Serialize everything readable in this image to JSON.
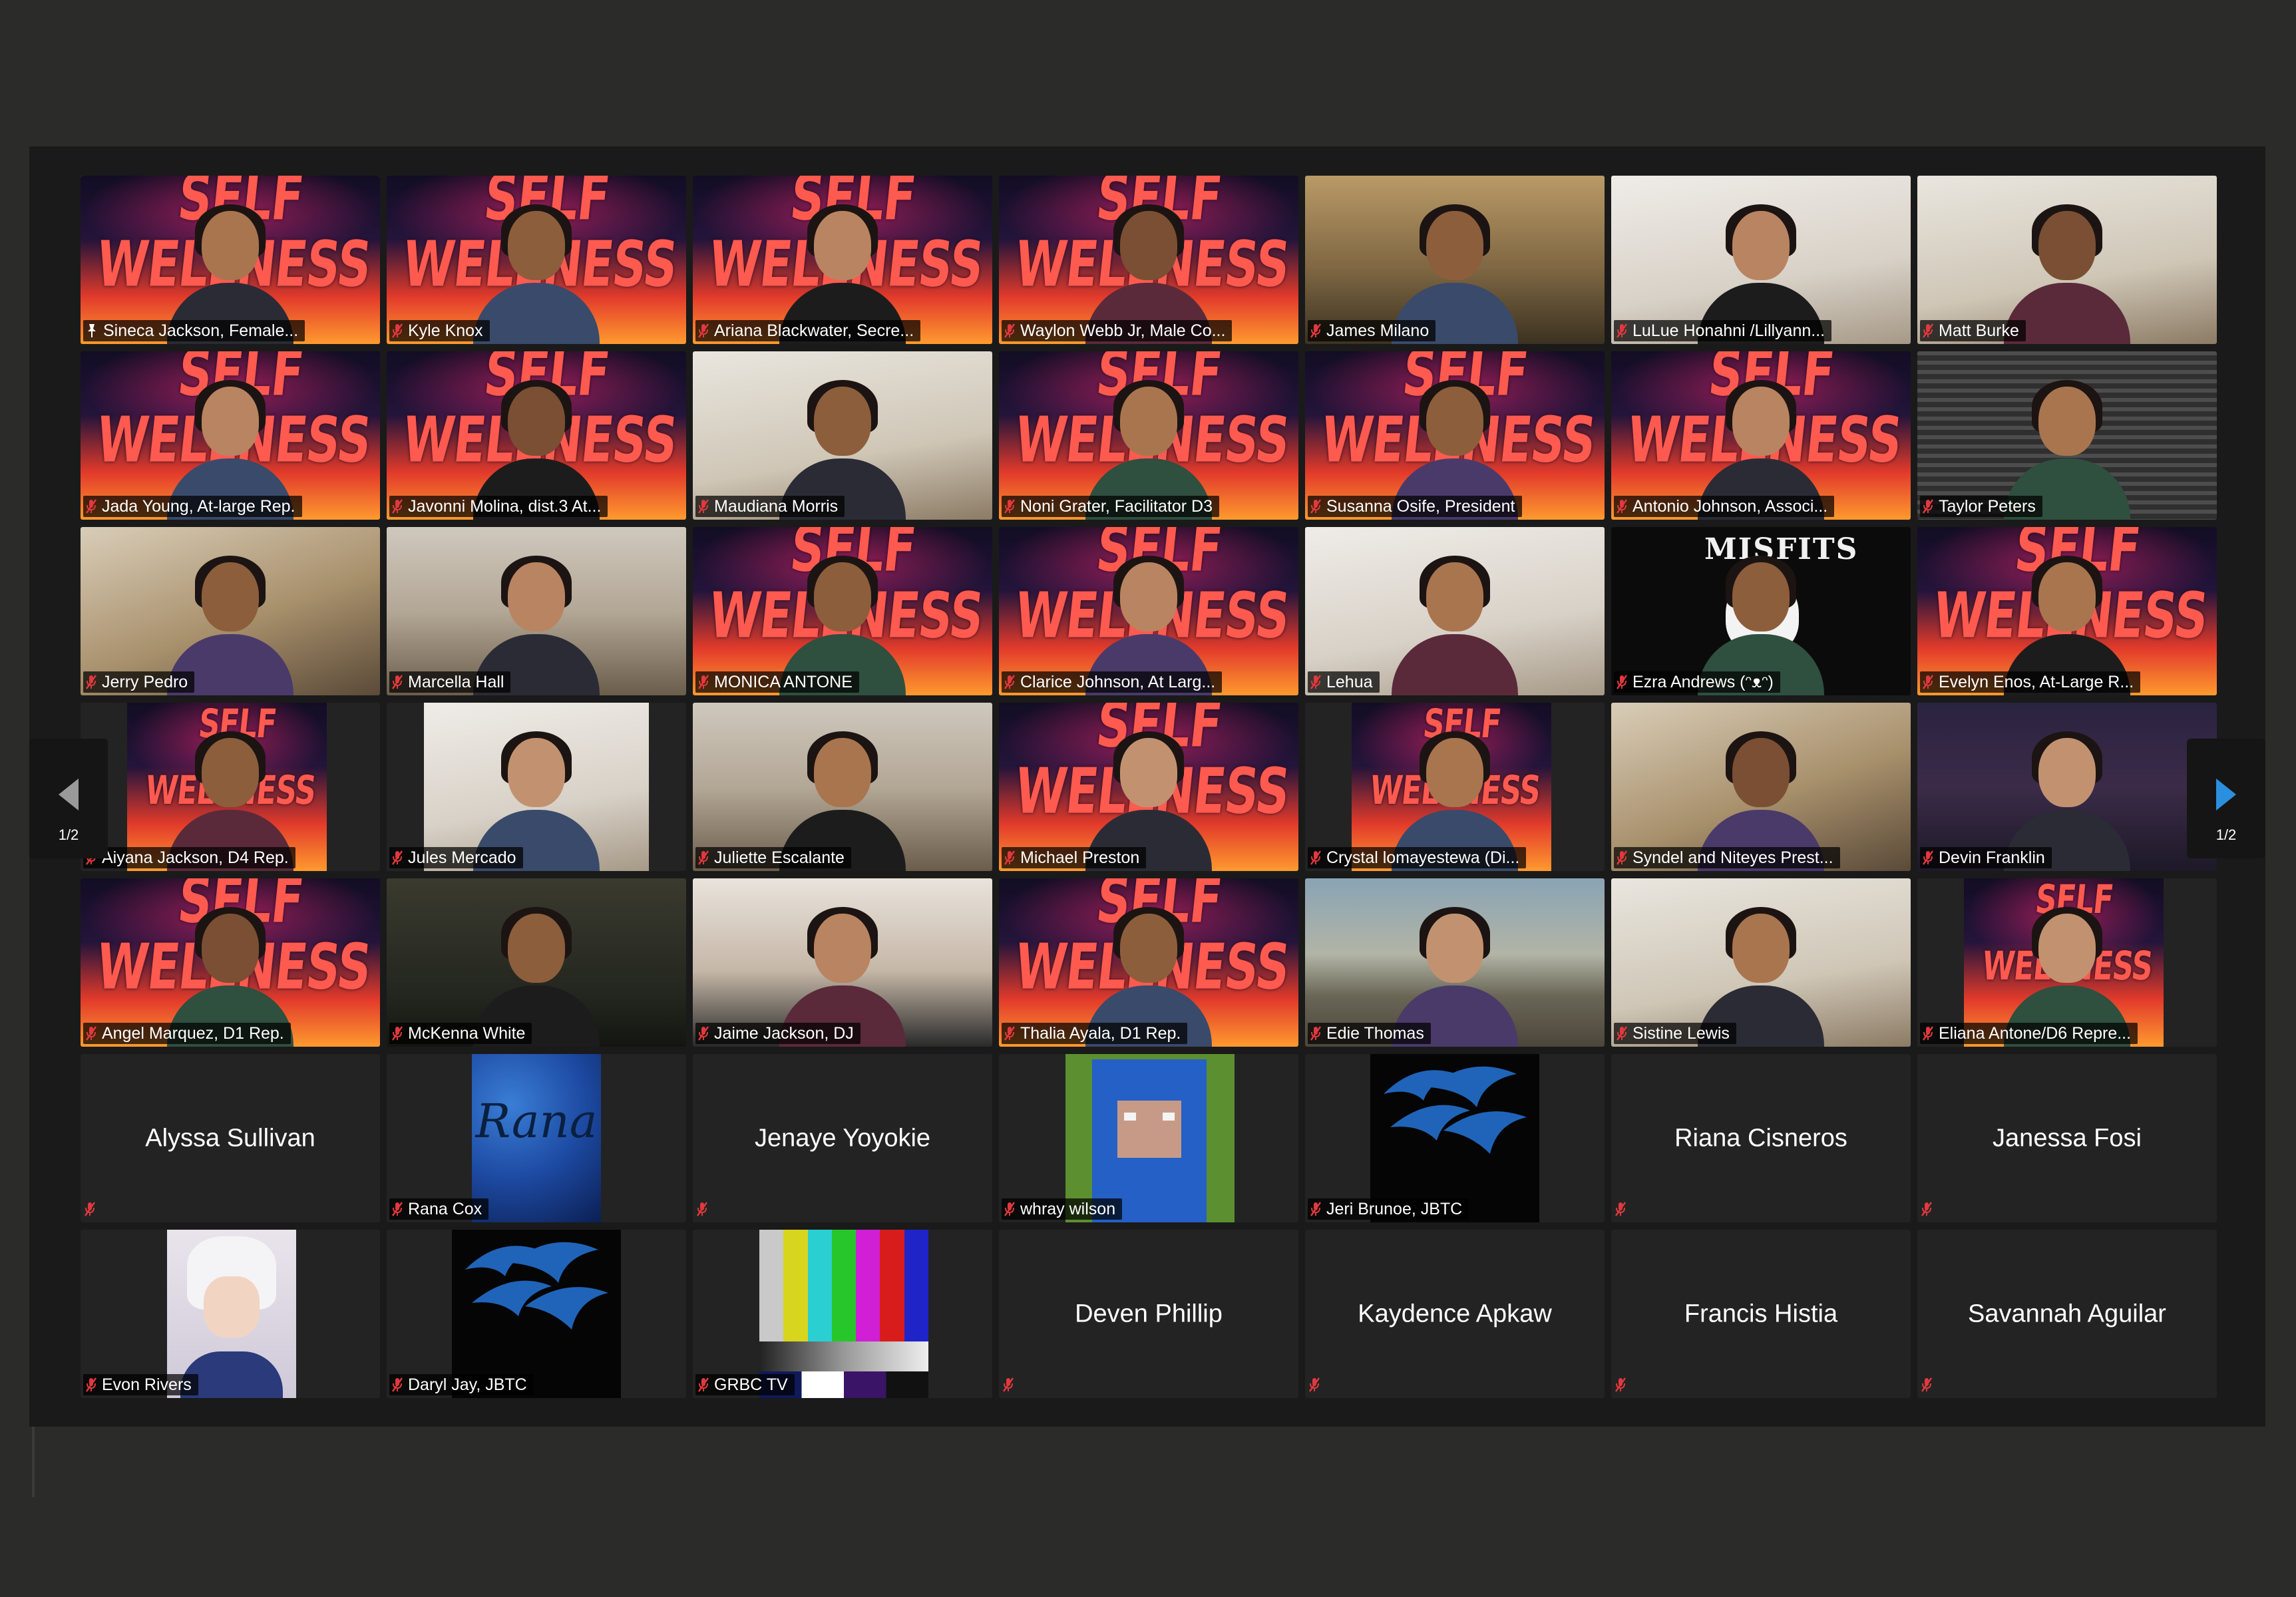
{
  "pagination": {
    "left_label": "1/2",
    "right_label": "1/2"
  },
  "colors": {
    "active_speaker_border": "#d9e36a",
    "muted_icon": "#e0393e",
    "tile_bg": "#232323"
  },
  "poster_text": "SELF WELLNESS AND GROWTH",
  "participants": [
    {
      "name": "Sineca Jackson, Female...",
      "bg": "poster",
      "active": true,
      "pinned": true
    },
    {
      "name": "Kyle Knox",
      "bg": "poster"
    },
    {
      "name": "Ariana Blackwater, Secre...",
      "bg": "poster"
    },
    {
      "name": "Waylon Webb Jr, Male Co...",
      "bg": "poster"
    },
    {
      "name": "James Milano",
      "bg": "office"
    },
    {
      "name": "LuLue Honahni /Lillyann...",
      "bg": "room4"
    },
    {
      "name": "Matt Burke",
      "bg": "room2"
    },
    {
      "name": "Jada Young, At-large Rep.",
      "bg": "poster"
    },
    {
      "name": "Javonni Molina, dist.3 At...",
      "bg": "poster"
    },
    {
      "name": "Maudiana Morris",
      "bg": "room2"
    },
    {
      "name": "Noni Grater, Facilitator D3",
      "bg": "poster"
    },
    {
      "name": "Susanna Osife, President",
      "bg": "poster"
    },
    {
      "name": "Antonio Johnson, Associ...",
      "bg": "poster"
    },
    {
      "name": "Taylor Peters",
      "bg": "blinds"
    },
    {
      "name": "Jerry Pedro",
      "bg": "room1"
    },
    {
      "name": "Marcella Hall",
      "bg": "room3"
    },
    {
      "name": "MONICA ANTONE",
      "bg": "poster"
    },
    {
      "name": "Clarice Johnson, At Larg...",
      "bg": "poster"
    },
    {
      "name": "Lehua",
      "bg": "room4"
    },
    {
      "name": "Ezra Andrews (ᵔᴥᵔ)",
      "bg": "black"
    },
    {
      "name": "Evelyn Enos, At-Large R...",
      "bg": "poster"
    },
    {
      "name": "Aiyana Jackson, D4 Rep.",
      "bg": "poster-narrow"
    },
    {
      "name": "Jules Mercado",
      "bg": "room4-narrow"
    },
    {
      "name": "Juliette Escalante",
      "bg": "room3"
    },
    {
      "name": "Michael Preston",
      "bg": "poster"
    },
    {
      "name": "Crystal lomayestewa (Di...",
      "bg": "poster-narrow"
    },
    {
      "name": "Syndel and Niteyes Prest...",
      "bg": "room1"
    },
    {
      "name": "Devin Franklin",
      "bg": "purple"
    },
    {
      "name": "Angel Marquez, D1 Rep.",
      "bg": "poster"
    },
    {
      "name": "McKenna White",
      "bg": "dark"
    },
    {
      "name": "Jaime Jackson, DJ",
      "bg": "studio"
    },
    {
      "name": "Thalia Ayala, D1 Rep.",
      "bg": "poster"
    },
    {
      "name": "Edie Thomas",
      "bg": "landscape"
    },
    {
      "name": "Sistine Lewis",
      "bg": "room2"
    },
    {
      "name": "Eliana Antone/D6 Repre...",
      "bg": "poster-narrow"
    },
    {
      "name": "Alyssa Sullivan",
      "bg": "none"
    },
    {
      "name": "Rana Cox",
      "bg": "avatar-rana"
    },
    {
      "name": "Jenaye Yoyokie",
      "bg": "none"
    },
    {
      "name": "whray wilson",
      "bg": "avatar-sheep"
    },
    {
      "name": "Jeri Brunoe, JBTC",
      "bg": "avatar-jbtc"
    },
    {
      "name": "Riana Cisneros",
      "bg": "none"
    },
    {
      "name": "Janessa Fosi",
      "bg": "none"
    },
    {
      "name": "Evon Rivers",
      "bg": "avatar-anime"
    },
    {
      "name": "Daryl Jay, JBTC",
      "bg": "avatar-jbtc2"
    },
    {
      "name": "GRBC TV",
      "bg": "avatar-tv"
    },
    {
      "name": "Deven Phillip",
      "bg": "none"
    },
    {
      "name": "Kaydence Apkaw",
      "bg": "none"
    },
    {
      "name": "Francis Histia",
      "bg": "none"
    },
    {
      "name": "Savannah Aguilar",
      "bg": "none"
    }
  ],
  "avatar_texts": {
    "rana_logo": "Rana",
    "misfits_logo": "MISFITS"
  }
}
